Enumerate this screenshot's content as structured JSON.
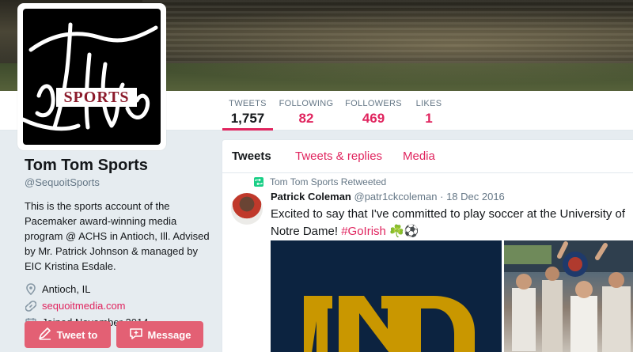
{
  "profile": {
    "avatar_text": "SPORTS",
    "name": "Tom Tom Sports",
    "handle": "@SequoitSports",
    "bio": "This is the sports account of the Pacemaker award-winning media program @ ACHS in Antioch, Ill. Advised by Mr. Patrick Johnson & managed by EIC Kristina Esdale.",
    "location": "Antioch, IL",
    "website": "sequoitmedia.com",
    "joined": "Joined November 2014",
    "tweet_to_label": "Tweet to",
    "message_label": "Message"
  },
  "stats": {
    "tweets": {
      "label": "TWEETS",
      "value": "1,757"
    },
    "following": {
      "label": "FOLLOWING",
      "value": "82"
    },
    "followers": {
      "label": "FOLLOWERS",
      "value": "469"
    },
    "likes": {
      "label": "LIKES",
      "value": "1"
    }
  },
  "timeline": {
    "tabs": [
      "Tweets",
      "Tweets & replies",
      "Media"
    ],
    "tweet": {
      "retweet_context": "Tom Tom Sports Retweeted",
      "author": "Patrick Coleman",
      "username": "@patr1ckcoleman",
      "separator": "·",
      "date": "18 Dec 2016",
      "text": "Excited to say that I've committed to play soccer at the University of Notre Dame!",
      "hashtag": "#GoIrish",
      "emoji": "☘️⚽"
    }
  },
  "colors": {
    "accent": "#e0245e",
    "button": "#e36074",
    "notre_dame_navy": "#0c2340",
    "notre_dame_gold": "#c99700"
  },
  "icons": {
    "location": "map-pin-icon",
    "website": "link-icon",
    "joined": "calendar-icon",
    "retweet": "retweet-icon",
    "tweet_to": "compose-icon",
    "message": "message-icon"
  }
}
